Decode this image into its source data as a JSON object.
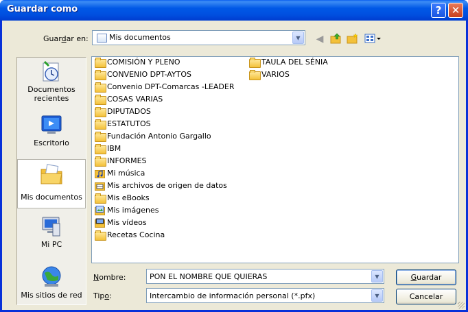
{
  "window": {
    "title": "Guardar como",
    "help_glyph": "?",
    "close_glyph": "✕"
  },
  "save_in": {
    "label_pre": "Guar",
    "label_accel": "d",
    "label_post": "ar en:",
    "value": "Mis documentos"
  },
  "toolbar": {
    "back_icon": "back-icon",
    "up_icon": "up-folder-icon",
    "new_folder_icon": "new-folder-icon",
    "views_icon": "views-menu-icon"
  },
  "places": [
    {
      "label": "Documentos recientes",
      "icon": "recent-documents-icon"
    },
    {
      "label": "Escritorio",
      "icon": "desktop-icon"
    },
    {
      "label": "Mis documentos",
      "icon": "my-documents-icon",
      "selected": true
    },
    {
      "label": "Mi PC",
      "icon": "my-computer-icon"
    },
    {
      "label": "Mis sitios de red",
      "icon": "network-places-icon"
    }
  ],
  "files": [
    {
      "name": "COMISIÓN Y PLENO",
      "type": "folder"
    },
    {
      "name": "CONVENIO DPT-AYTOS",
      "type": "folder"
    },
    {
      "name": "Convenio DPT-Comarcas -LEADER",
      "type": "folder"
    },
    {
      "name": "COSAS VARIAS",
      "type": "folder"
    },
    {
      "name": "DIPUTADOS",
      "type": "folder"
    },
    {
      "name": "ESTATUTOS",
      "type": "folder"
    },
    {
      "name": "Fundación Antonio Gargallo",
      "type": "folder"
    },
    {
      "name": "IBM",
      "type": "folder"
    },
    {
      "name": "INFORMES",
      "type": "folder"
    },
    {
      "name": "Mi música",
      "type": "music"
    },
    {
      "name": "Mis archivos de origen de datos",
      "type": "data"
    },
    {
      "name": "Mis eBooks",
      "type": "folder"
    },
    {
      "name": "Mis imágenes",
      "type": "pictures"
    },
    {
      "name": "Mis vídeos",
      "type": "videos"
    },
    {
      "name": "Recetas Cocina",
      "type": "folder"
    },
    {
      "name": "TAULA DEL SÉNIA",
      "type": "folder"
    },
    {
      "name": "VARIOS",
      "type": "folder"
    }
  ],
  "name_field": {
    "label_accel": "N",
    "label_post": "ombre:",
    "value": "PON EL NOMBRE QUE QUIERAS"
  },
  "type_field": {
    "label_pre": "Tip",
    "label_accel": "o",
    "label_post": ":",
    "value": "Intercambio de información personal (*.pfx)"
  },
  "buttons": {
    "save_accel": "G",
    "save_post": "uardar",
    "cancel": "Cancelar"
  },
  "colors": {
    "title_bar": "#0058e6",
    "window_bg": "#ece9d8",
    "folder": "#f3c13a"
  }
}
